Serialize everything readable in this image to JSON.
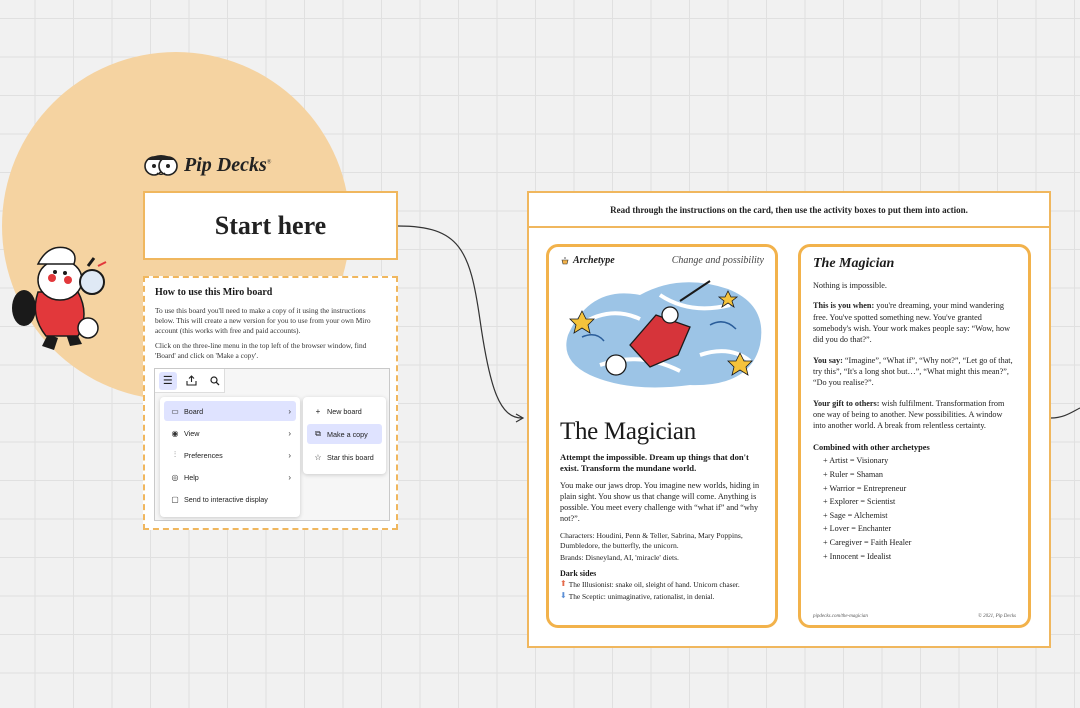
{
  "brand": {
    "name": "Pip Decks",
    "mark": "®"
  },
  "start": {
    "label": "Start here"
  },
  "howto": {
    "title": "How to use this Miro board",
    "para1": "To use this board you'll need to make a copy of it using the instructions below. This will create a new version for you to use from your own Miro account (this works with free and paid accounts).",
    "para2": "Click on the three-line menu in the top left of the browser window, find 'Board' and click on 'Make a copy'.",
    "menu": [
      {
        "label": "Board",
        "icon": "board-icon",
        "selected": true
      },
      {
        "label": "View",
        "icon": "eye-icon"
      },
      {
        "label": "Preferences",
        "icon": "sliders-icon"
      },
      {
        "label": "Help",
        "icon": "globe-icon"
      },
      {
        "label": "Send to interactive display",
        "icon": "display-icon"
      }
    ],
    "submenu": [
      {
        "label": "New board",
        "icon": "plus-icon"
      },
      {
        "label": "Make a copy",
        "icon": "copy-icon",
        "selected": true
      },
      {
        "label": "Star this board",
        "icon": "star-icon"
      }
    ]
  },
  "frame": {
    "header": "Read through the instructions on the card, then use the activity boxes to put them into action."
  },
  "card1": {
    "label": "Archetype",
    "tagline": "Change and possibility",
    "title": "The Magician",
    "lead": "Attempt the impossible. Dream up things that don't exist. Transform the mundane world.",
    "body": "You make our jaws drop. You imagine new worlds, hiding in plain sight. You show us that change will come. Anything is possible. You meet every challenge with “what if” and “why not?”.",
    "characters": "Characters: Houdini, Penn & Teller, Sabrina, Mary Poppins, Dumbledore, the butterfly, the unicorn.",
    "brands": "Brands: Disneyland, AI, 'miracle' diets.",
    "dark_heading": "Dark sides",
    "dark1": "The Illusionist: snake oil, sleight of hand. Unicorn chaser.",
    "dark2": "The Sceptic: unimaginative, rationalist, in denial."
  },
  "card2": {
    "title": "The Magician",
    "intro": "Nothing is impossible.",
    "when_label": "This is you when:",
    "when_text": "you're dreaming, your mind wandering free. You've spotted something new. You've granted somebody's wish. Your work makes people say: “Wow, how did you do that?”.",
    "say_label": "You say:",
    "say_text": "“Imagine”, “What if”, “Why not?”, “Let go of that, try this”, “It's a long shot but…”, “What might this mean?”, “Do you realise?”.",
    "gift_label": "Your gift to others:",
    "gift_text": "wish fulfilment. Transformation from one way of being to another. New possibilities. A window into another world. A break from relentless certainty.",
    "combined_heading": "Combined with other archetypes",
    "combos": [
      "+ Artist = Visionary",
      "+ Ruler = Shaman",
      "+ Warrior = Entrepreneur",
      "+ Explorer = Scientist",
      "+ Sage = Alchemist",
      "+ Lover = Enchanter",
      "+ Caregiver = Faith Healer",
      "+ Innocent = Idealist"
    ],
    "footer_left": "pipdecks.com/the-magician",
    "footer_right": "© 2021, Pip Decks"
  },
  "colors": {
    "accent": "#f0b75e",
    "circle": "#f5d3a1",
    "menu_selected": "#dfe3ff"
  }
}
